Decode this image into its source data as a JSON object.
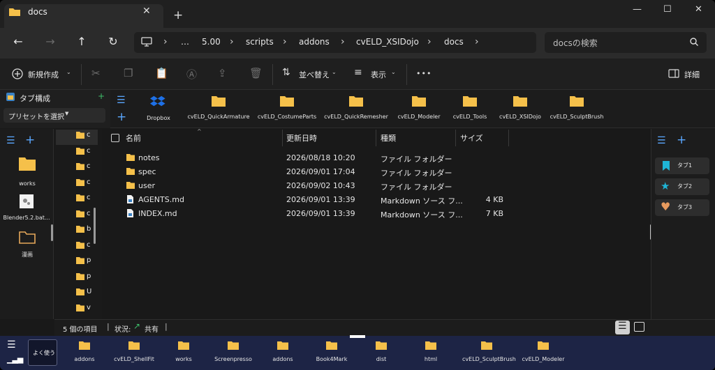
{
  "window": {
    "tab_title": "docs",
    "min": "—",
    "max": "☐",
    "close": "✕",
    "new_tab": "+",
    "tab_close": "✕"
  },
  "address": {
    "crumbs": [
      "…",
      "5.00",
      "scripts",
      "addons",
      "cvELD_XSIDojo",
      "docs"
    ],
    "search_placeholder": "docsの検索"
  },
  "commands": {
    "new": "新規作成",
    "sort": "並べ替え",
    "view": "表示",
    "more": "•••",
    "details": "詳細"
  },
  "tabgroup": {
    "title": "タブ構成",
    "preset": "プリセットを選択",
    "add": "+"
  },
  "favorites": [
    {
      "label": "Dropbox",
      "icon": "dropbox-icon"
    },
    {
      "label": "cvELD_QuickArmature",
      "icon": "folder-icon"
    },
    {
      "label": "cvELD_CostumeParts",
      "icon": "folder-icon"
    },
    {
      "label": "cvELD_QuickRemesher",
      "icon": "folder-icon"
    },
    {
      "label": "cvELD_Modeler",
      "icon": "folder-icon"
    },
    {
      "label": "cvELD_Tools",
      "icon": "folder-icon"
    },
    {
      "label": "cvELD_XSIDojo",
      "icon": "folder-icon"
    },
    {
      "label": "cvELD_SculptBrush",
      "icon": "folder-icon"
    }
  ],
  "left_items": [
    {
      "label": "works",
      "icon": "folder-icon"
    },
    {
      "label": "Blender5.2.bat...",
      "icon": "bat-file-icon"
    },
    {
      "label": "漫画",
      "icon": "folder-outline-icon"
    }
  ],
  "tree_letters": [
    "c",
    "c",
    "c",
    "c",
    "c",
    "c",
    "b",
    "c",
    "p",
    "p",
    "U",
    "v"
  ],
  "columns": {
    "name": "名前",
    "modified": "更新日時",
    "type": "種類",
    "size": "サイズ"
  },
  "files": [
    {
      "name": "notes",
      "modified": "2026/08/18 10:20",
      "type": "ファイル フォルダー",
      "size": "",
      "icon": "folder-icon"
    },
    {
      "name": "spec",
      "modified": "2026/09/01 17:04",
      "type": "ファイル フォルダー",
      "size": "",
      "icon": "folder-icon"
    },
    {
      "name": "user",
      "modified": "2026/09/02 10:43",
      "type": "ファイル フォルダー",
      "size": "",
      "icon": "folder-icon"
    },
    {
      "name": "AGENTS.md",
      "modified": "2026/09/01 13:39",
      "type": "Markdown ソース フ...",
      "size": "4 KB",
      "icon": "markdown-file-icon"
    },
    {
      "name": "INDEX.md",
      "modified": "2026/09/01 13:39",
      "type": "Markdown ソース フ...",
      "size": "7 KB",
      "icon": "markdown-file-icon"
    }
  ],
  "tabs_right": [
    {
      "label": "タブ1",
      "icon": "bookmark-icon",
      "color": "#1fb5d6"
    },
    {
      "label": "タブ2",
      "icon": "star-icon",
      "color": "#1fb5d6"
    },
    {
      "label": "タブ3",
      "icon": "heart-icon",
      "color": "#e79a5e"
    }
  ],
  "status": {
    "count": "5 個の項目",
    "state_label": "状況:",
    "share": "共有"
  },
  "bottom": {
    "frequent": "よく使う",
    "items": [
      "addons",
      "cvELD_ShellFit",
      "works",
      "Screenpresso",
      "addons",
      "Book4Mark",
      "dist",
      "html",
      "cvELD_SculptBrush",
      "cvELD_Modeler"
    ]
  },
  "colors": {
    "folder": "#f5c04a",
    "accent": "#1d2445"
  }
}
